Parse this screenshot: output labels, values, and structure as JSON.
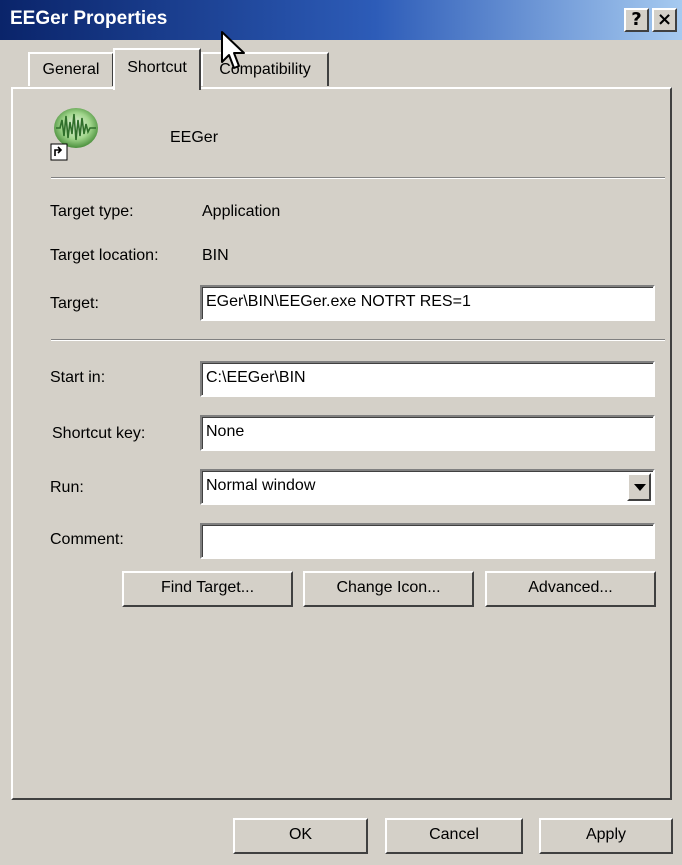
{
  "window": {
    "title": "EEGer Properties",
    "help_label": "?",
    "close_label": "×"
  },
  "tabs": [
    {
      "label": "General"
    },
    {
      "label": "Shortcut"
    },
    {
      "label": "Compatibility"
    }
  ],
  "shortcut": {
    "name": "EEGer",
    "icon": "eeger-app-icon",
    "target_type_label": "Target type:",
    "target_type_value": "Application",
    "target_location_label": "Target location:",
    "target_location_value": "BIN",
    "target_label": "Target:",
    "target_value": "EGer\\BIN\\EEGer.exe NOTRT RES=1",
    "start_in_label": "Start in:",
    "start_in_value": "C:\\EEGer\\BIN",
    "shortcut_key_label": "Shortcut key:",
    "shortcut_key_value": "None",
    "run_label": "Run:",
    "run_value": "Normal window",
    "comment_label": "Comment:",
    "comment_value": "",
    "find_target_label": "Find Target...",
    "change_icon_label": "Change Icon...",
    "advanced_label": "Advanced..."
  },
  "footer": {
    "ok_label": "OK",
    "cancel_label": "Cancel",
    "apply_label": "Apply"
  },
  "colors": {
    "titlebar_start": "#0a246a",
    "titlebar_end": "#a6caf0",
    "face": "#d4d0c8"
  }
}
